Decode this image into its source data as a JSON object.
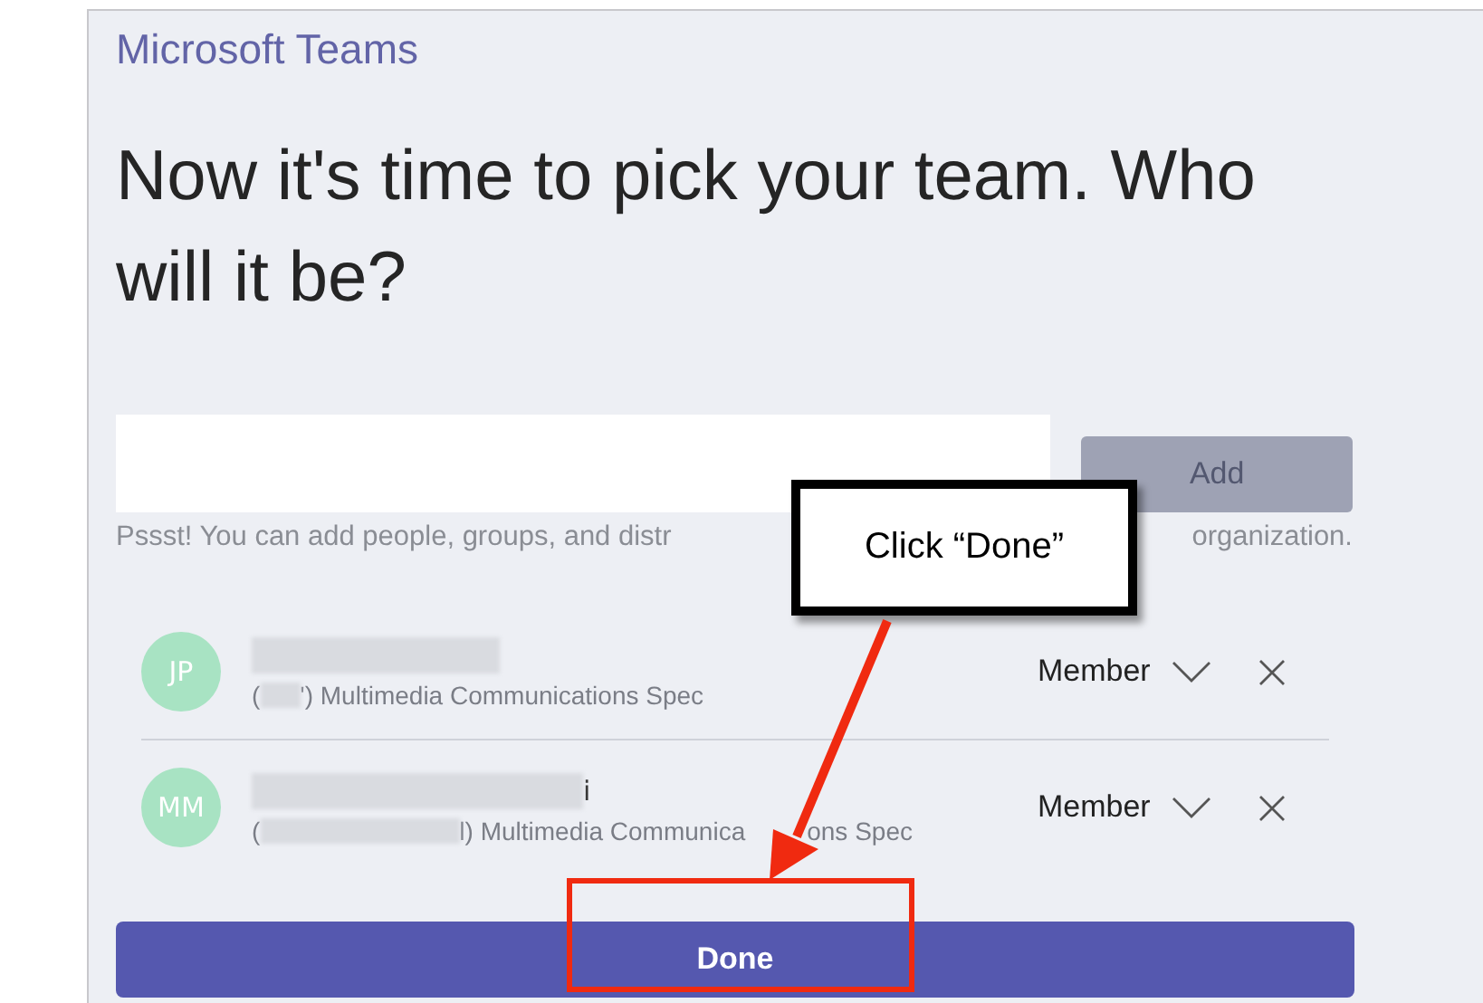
{
  "app_title": "Microsoft Teams",
  "heading": "Now it's time to pick your team. Who will it be?",
  "add_button": "Add",
  "hint": {
    "visible_start": "Pssst! You can add people, groups, and distr",
    "visible_end": "organization."
  },
  "members": [
    {
      "initials": "JP",
      "subtitle_open": "(",
      "subtitle_rest": "') Multimedia Communications Spec",
      "role": "Member"
    },
    {
      "initials": "MM",
      "name_suffix": "i",
      "subtitle_open": "(",
      "subtitle_rest": "l) Multimedia Communica",
      "subtitle_end": "ons Spec",
      "role": "Member"
    }
  ],
  "done_button": "Done",
  "callout": {
    "text": "Click “Done”"
  }
}
